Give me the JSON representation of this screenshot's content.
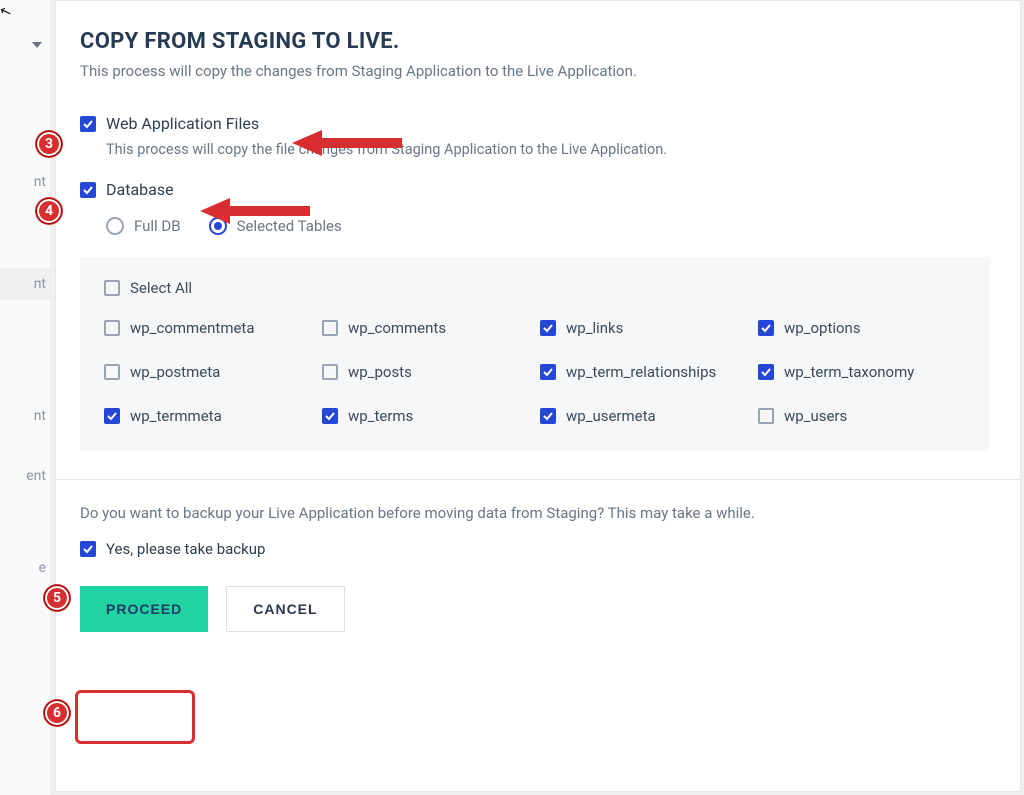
{
  "sidebar": {
    "items": [
      "nt",
      "nt",
      "nt",
      "ent",
      "e"
    ]
  },
  "modal": {
    "title": "COPY FROM STAGING TO LIVE.",
    "subtitle": "This process will copy the changes from Staging Application to the Live Application.",
    "web_files": {
      "label": "Web Application Files",
      "checked": true,
      "desc": "This process will copy the file changes from Staging Application to the Live Application."
    },
    "database": {
      "label": "Database",
      "checked": true,
      "radios": {
        "full": "Full DB",
        "selected": "Selected Tables",
        "value": "selected"
      },
      "select_all": {
        "label": "Select All",
        "checked": false
      },
      "tables": [
        {
          "name": "wp_commentmeta",
          "checked": false
        },
        {
          "name": "wp_comments",
          "checked": false
        },
        {
          "name": "wp_links",
          "checked": true
        },
        {
          "name": "wp_options",
          "checked": true
        },
        {
          "name": "wp_postmeta",
          "checked": false
        },
        {
          "name": "wp_posts",
          "checked": false
        },
        {
          "name": "wp_term_relationships",
          "checked": true
        },
        {
          "name": "wp_term_taxonomy",
          "checked": true
        },
        {
          "name": "wp_termmeta",
          "checked": true
        },
        {
          "name": "wp_terms",
          "checked": true
        },
        {
          "name": "wp_usermeta",
          "checked": true
        },
        {
          "name": "wp_users",
          "checked": false
        }
      ]
    },
    "backup": {
      "question": "Do you want to backup your Live Application before moving data from Staging? This may take a while.",
      "checkbox_label": "Yes, please take backup",
      "checked": true
    },
    "actions": {
      "proceed": "PROCEED",
      "cancel": "CANCEL"
    }
  },
  "annotations": {
    "b3": "3",
    "b4": "4",
    "b5": "5",
    "b6": "6"
  }
}
